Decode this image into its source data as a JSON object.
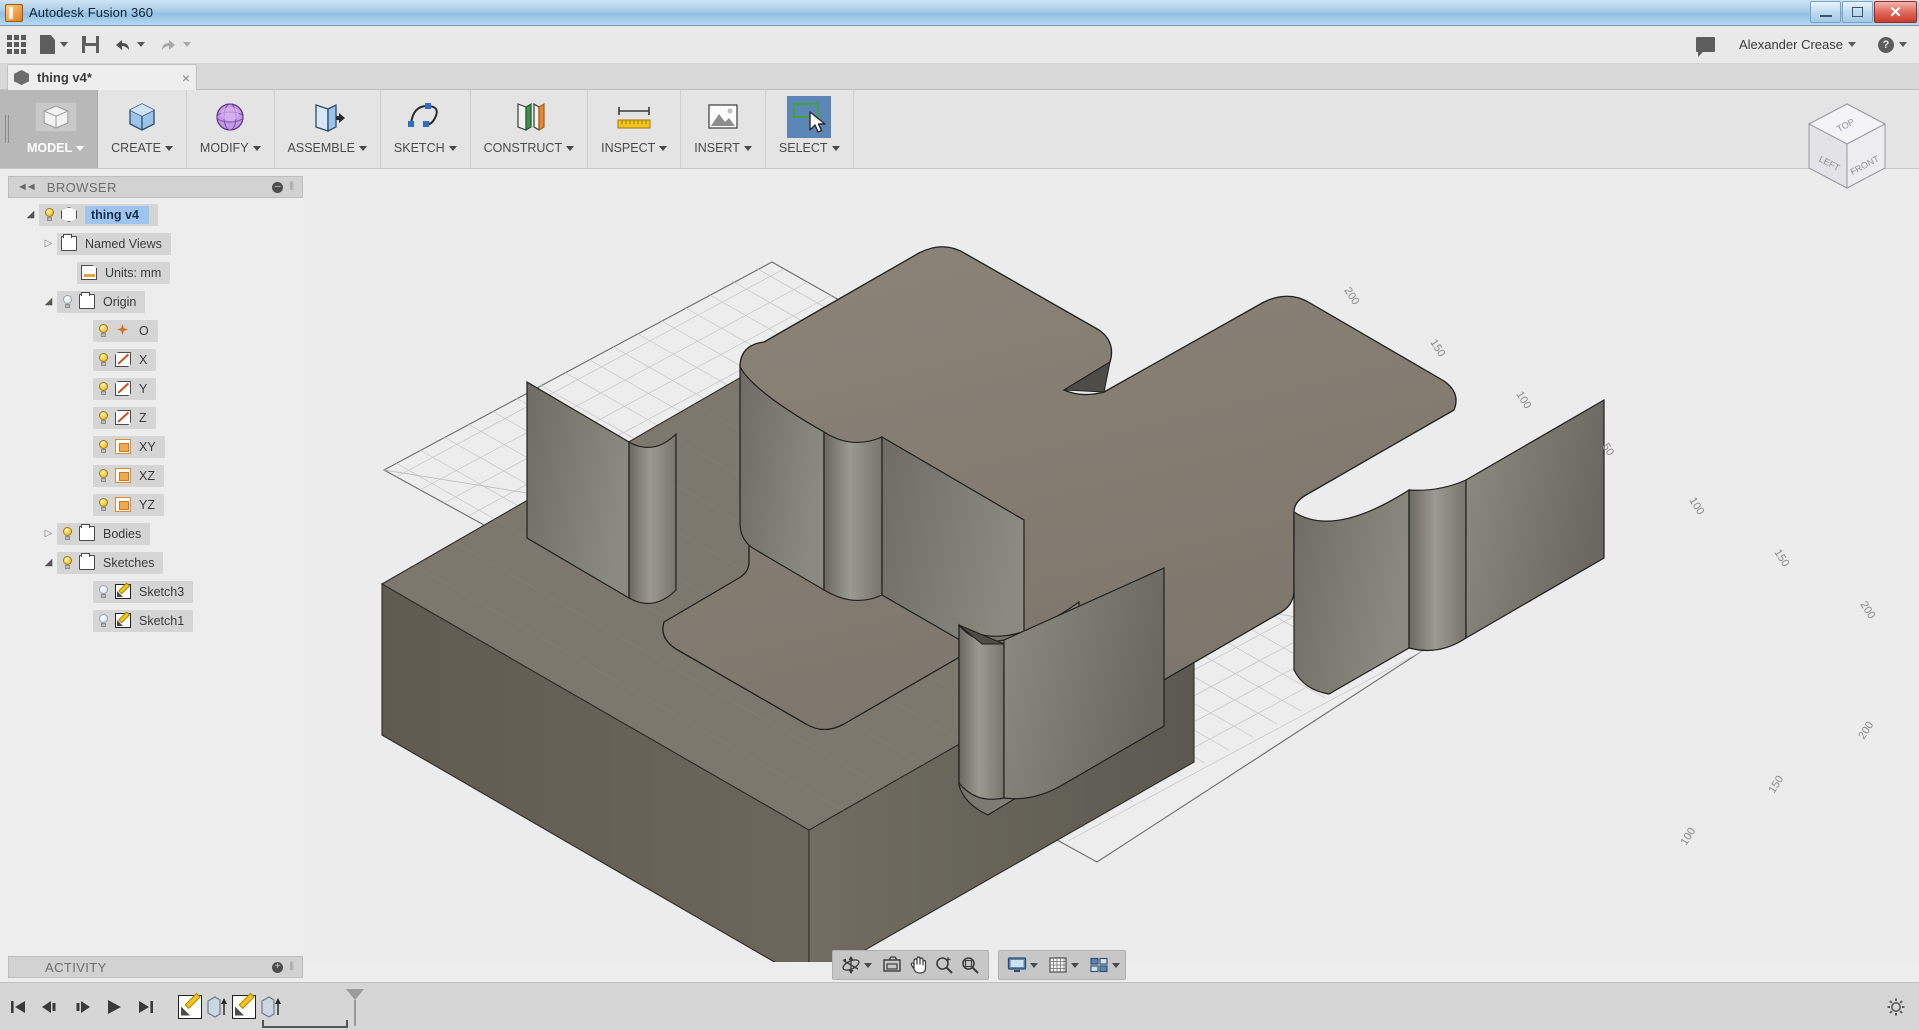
{
  "window": {
    "title": "Autodesk Fusion 360",
    "app_icon": "fusion-logo-icon",
    "minimize_label": "Minimize",
    "maximize_label": "Restore",
    "close_label": "Close"
  },
  "quick_access": {
    "items": [
      {
        "name": "app-grid",
        "icon": "grid-icon",
        "has_caret": false
      },
      {
        "name": "file",
        "icon": "file-icon",
        "has_caret": true
      },
      {
        "name": "save",
        "icon": "save-icon",
        "has_caret": false
      },
      {
        "name": "undo",
        "icon": "undo-arrow-icon",
        "has_caret": true
      },
      {
        "name": "redo",
        "icon": "redo-arrow-icon",
        "has_caret": true
      }
    ],
    "messages_icon": "speech-bubble-icon",
    "user_name": "Alexander Crease",
    "help_icon": "question-mark-icon"
  },
  "document_tab": {
    "label": "thing v4*",
    "icon": "cube-icon",
    "close": "×"
  },
  "ribbon": {
    "workspace": {
      "label": "MODEL",
      "icon": "model-cube-icon",
      "active": true
    },
    "panels": [
      {
        "label": "CREATE",
        "icon": "create-box-icon"
      },
      {
        "label": "MODIFY",
        "icon": "modify-sphere-icon"
      },
      {
        "label": "ASSEMBLE",
        "icon": "assemble-joint-icon"
      },
      {
        "label": "SKETCH",
        "icon": "sketch-spline-icon"
      },
      {
        "label": "CONSTRUCT",
        "icon": "construct-planes-icon"
      },
      {
        "label": "INSPECT",
        "icon": "inspect-measure-icon"
      },
      {
        "label": "INSERT",
        "icon": "insert-image-icon"
      },
      {
        "label": "SELECT",
        "icon": "select-cursor-icon",
        "active": true
      }
    ]
  },
  "browser": {
    "title": "BROWSER",
    "collapse_icon": "double-left-arrow-icon",
    "settings_icon": "minus-circle-icon",
    "tree": [
      {
        "depth": 0,
        "twisty": "open",
        "bulb": "on",
        "icon": "cube",
        "label": "thing v4",
        "selected": true
      },
      {
        "depth": 1,
        "twisty": "closed",
        "bulb": "none",
        "icon": "folder",
        "label": "Named Views",
        "selected": false
      },
      {
        "depth": 2,
        "twisty": "none",
        "bulb": "none",
        "icon": "doc",
        "label": "Units: mm",
        "selected": false
      },
      {
        "depth": 1,
        "twisty": "open",
        "bulb": "off",
        "icon": "folder",
        "label": "Origin",
        "selected": false
      },
      {
        "depth": 3,
        "twisty": "none",
        "bulb": "on",
        "icon": "origin",
        "label": "O",
        "selected": false
      },
      {
        "depth": 3,
        "twisty": "none",
        "bulb": "on",
        "icon": "axis",
        "label": "X",
        "selected": false
      },
      {
        "depth": 3,
        "twisty": "none",
        "bulb": "on",
        "icon": "axis",
        "label": "Y",
        "selected": false
      },
      {
        "depth": 3,
        "twisty": "none",
        "bulb": "on",
        "icon": "axis",
        "label": "Z",
        "selected": false
      },
      {
        "depth": 3,
        "twisty": "none",
        "bulb": "on",
        "icon": "plane",
        "label": "XY",
        "selected": false
      },
      {
        "depth": 3,
        "twisty": "none",
        "bulb": "on",
        "icon": "plane",
        "label": "XZ",
        "selected": false
      },
      {
        "depth": 3,
        "twisty": "none",
        "bulb": "on",
        "icon": "plane",
        "label": "YZ",
        "selected": false
      },
      {
        "depth": 1,
        "twisty": "closed",
        "bulb": "on",
        "icon": "folder",
        "label": "Bodies",
        "selected": false
      },
      {
        "depth": 1,
        "twisty": "open",
        "bulb": "on",
        "icon": "folder",
        "label": "Sketches",
        "selected": false
      },
      {
        "depth": 3,
        "twisty": "none",
        "bulb": "off",
        "icon": "sketch",
        "label": "Sketch3",
        "selected": false
      },
      {
        "depth": 3,
        "twisty": "none",
        "bulb": "off",
        "icon": "sketch",
        "label": "Sketch1",
        "selected": false
      }
    ]
  },
  "viewport": {
    "background_color": "#ececec",
    "model_color_top": "#837d72",
    "model_color_side": "#7c7a72",
    "model_color_base": "#6d685d",
    "grid_labels_back_left": [
      "200",
      "150",
      "100",
      "50"
    ],
    "grid_labels_back_right": [
      "50",
      "100",
      "150",
      "200"
    ],
    "grid_labels_front_right": [
      "200",
      "150",
      "100"
    ],
    "axis_x_color": "#cf4b4b",
    "axis_y_color": "#6a6ad2",
    "grid_line_color": "#c3c3c3"
  },
  "view_cube": {
    "faces": [
      "TOP",
      "LEFT",
      "FRONT"
    ]
  },
  "nav_bar": {
    "group_one": [
      {
        "name": "orbit",
        "icon": "orbit-icon",
        "caret": true
      },
      {
        "name": "look-at",
        "icon": "look-at-icon",
        "caret": false
      },
      {
        "name": "pan",
        "icon": "hand-pan-icon",
        "caret": false
      },
      {
        "name": "zoom",
        "icon": "zoom-magnifier-icon",
        "caret": false
      },
      {
        "name": "fit",
        "icon": "fit-view-icon",
        "caret": false
      }
    ],
    "group_two": [
      {
        "name": "display-settings",
        "icon": "monitor-icon",
        "caret": true
      },
      {
        "name": "grid-snaps",
        "icon": "grid-icon",
        "caret": true
      },
      {
        "name": "viewports",
        "icon": "viewports-icon",
        "caret": true
      }
    ]
  },
  "activity": {
    "title": "ACTIVITY",
    "expand_icon": "plus-circle-icon"
  },
  "timeline": {
    "controls": [
      {
        "name": "go-to-beginning",
        "icon": "skip-back-icon"
      },
      {
        "name": "step-back",
        "icon": "step-back-icon"
      },
      {
        "name": "step-forward",
        "icon": "step-forward-icon"
      },
      {
        "name": "play",
        "icon": "play-icon"
      },
      {
        "name": "go-to-end",
        "icon": "skip-forward-icon"
      }
    ],
    "features": [
      {
        "name": "sketch3-feature",
        "icon": "sketch-icon"
      },
      {
        "name": "extrude1-feature",
        "icon": "extrude-icon"
      },
      {
        "name": "sketch1-feature",
        "icon": "sketch-icon"
      },
      {
        "name": "extrude2-feature",
        "icon": "extrude-icon"
      }
    ],
    "settings_icon": "gear-icon"
  }
}
